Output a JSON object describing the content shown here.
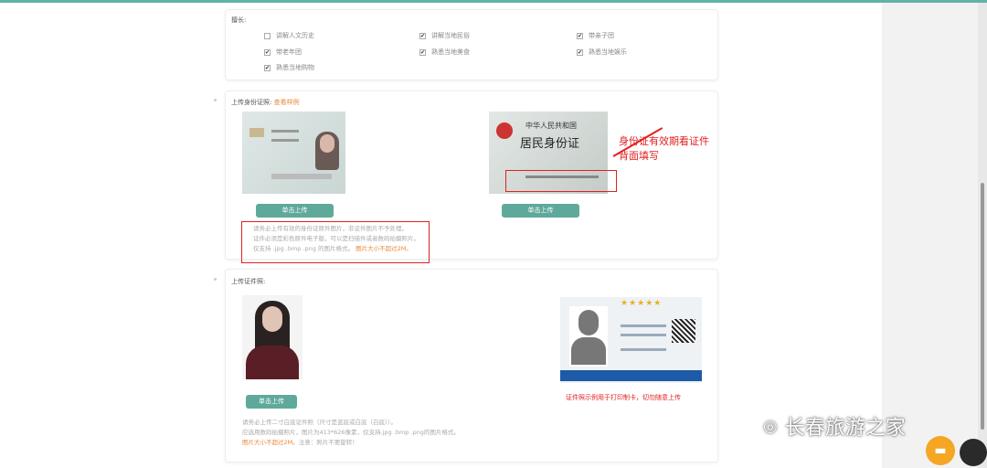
{
  "skills": {
    "label": "擅长:",
    "options": [
      {
        "label": "讲解人文历史",
        "checked": false
      },
      {
        "label": "讲解当地民俗",
        "checked": true
      },
      {
        "label": "带亲子团",
        "checked": true
      },
      {
        "label": "带老年团",
        "checked": true
      },
      {
        "label": "熟悉当地美食",
        "checked": true
      },
      {
        "label": "熟悉当地娱乐",
        "checked": true
      },
      {
        "label": "熟悉当地购物",
        "checked": true
      }
    ]
  },
  "id_upload": {
    "label": "上传身份证照:",
    "sample_link": "查看样例",
    "upload_front": "单击上传",
    "upload_back": "单击上传",
    "back_title": "中华人民共和国",
    "back_subtitle": "居民身份证",
    "annotation": "身份证有效期看证件背面填写",
    "note_1": "请务必上传有效的身份证原件图片，非证件图片不予处理。",
    "note_2": "证件必须是彩色原件电子版，可以是扫描件或者数码拍摄照片。",
    "note_3": "仅支持 .jpg .bmp .png 的图片格式。",
    "note_limit": "图片大小不超过2M。"
  },
  "photo_upload": {
    "label": "上传证件照:",
    "upload": "单击上传",
    "note_1": "请务必上传二寸白底证件照（尺寸是蓝底或白底（白底））。",
    "note_2": "应选用数码拍摄照片，图片为413*626像素，仅支持.jpg .bmp .png的图片格式。",
    "note_limit": "图片大小不超过2M。",
    "note_3": "注意：照片不要旋转！",
    "sample_caption": "证件照示例用于打印制卡，切勿随意上传",
    "stars": "★★★★★"
  },
  "watermark": "长春旅游之家"
}
